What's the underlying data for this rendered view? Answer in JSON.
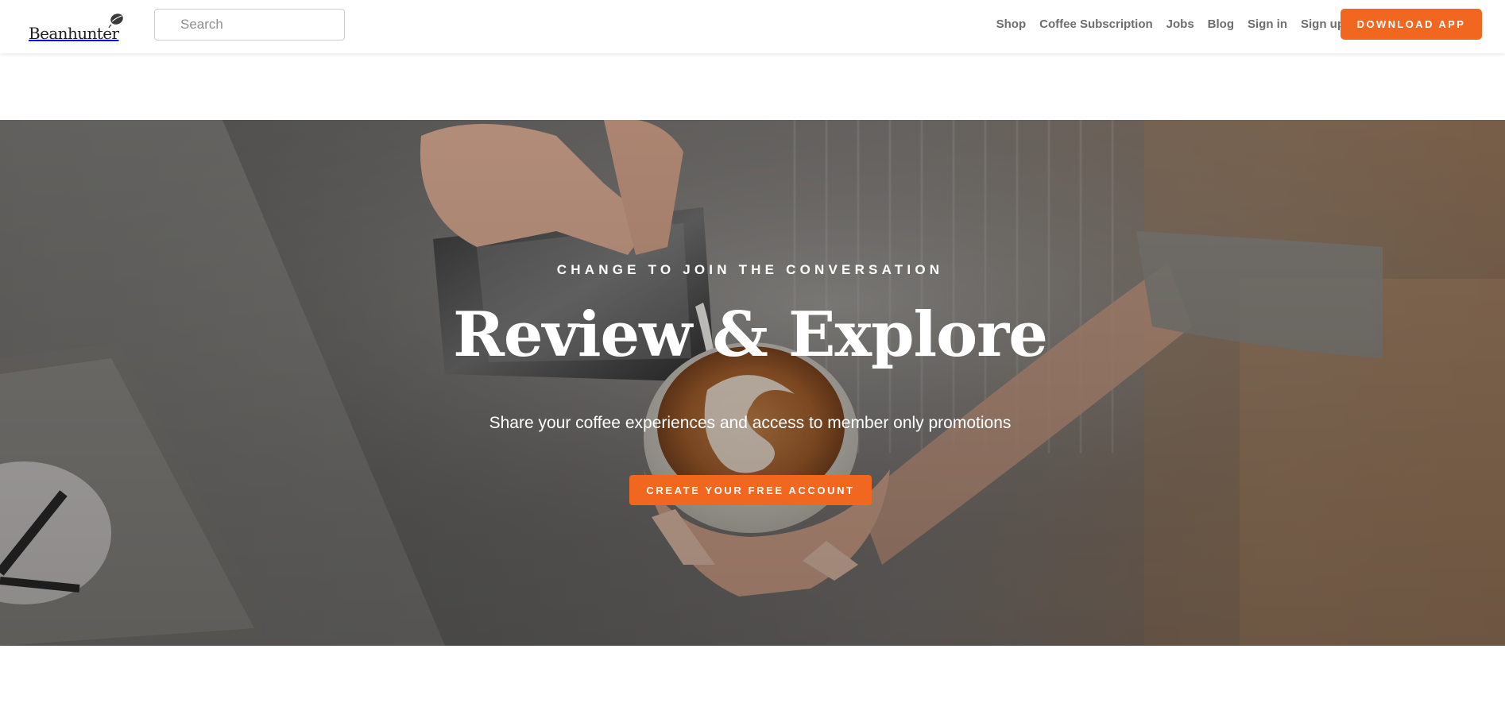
{
  "header": {
    "logo_text": "Beanhunter",
    "search": {
      "placeholder": "Search",
      "value": ""
    },
    "nav": {
      "shop": "Shop",
      "coffee_subscription": "Coffee Subscription",
      "jobs": "Jobs",
      "blog": "Blog",
      "sign_in": "Sign in",
      "sign_up": "Sign up"
    },
    "download_label": "DOWNLOAD APP"
  },
  "hero": {
    "eyebrow": "CHANGE TO JOIN THE CONVERSATION",
    "headline": "Review & Explore",
    "subline": "Share your coffee experiences and access to member only promotions",
    "cta_label": "CREATE YOUR FREE ACCOUNT",
    "background_image": "latte-art-pour-photo"
  },
  "colors": {
    "accent": "#f2671f",
    "nav_text": "#6e6e6e",
    "background": "#ffffff",
    "hero_text": "#ffffff"
  }
}
